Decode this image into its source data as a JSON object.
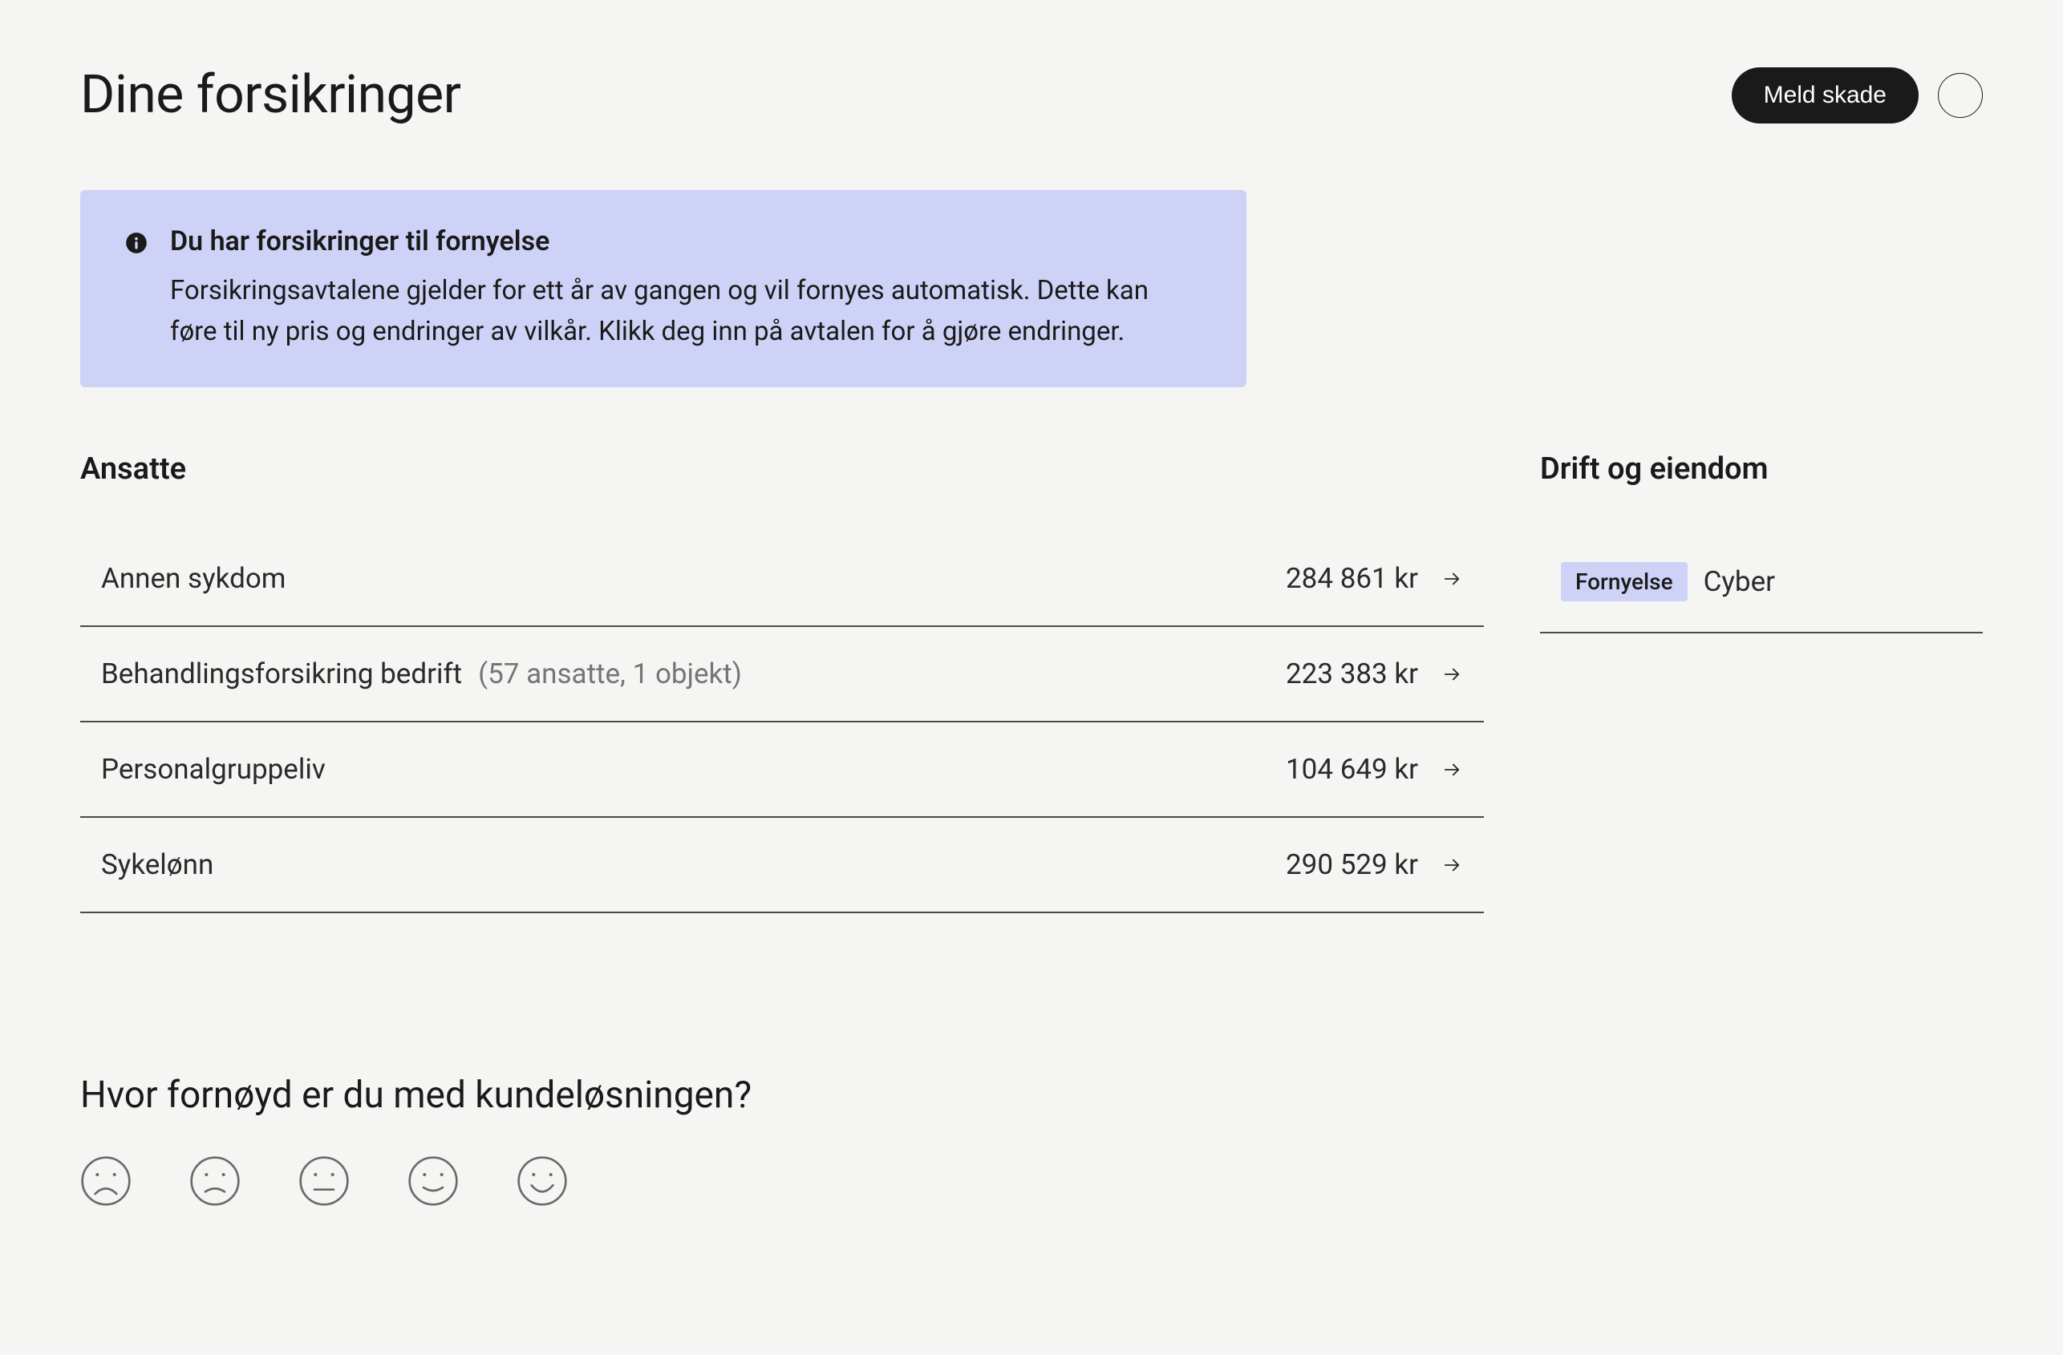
{
  "header": {
    "title": "Dine forsikringer",
    "cta_label": "Meld skade"
  },
  "alert": {
    "title": "Du har forsikringer til fornyelse",
    "body": "Forsikringsavtalene gjelder for ett år av gangen og vil fornyes automatisk. Dette kan føre til ny pris og endringer av vilkår. Klikk deg inn på avtalen for å gjøre endringer."
  },
  "sections": {
    "left": {
      "title": "Ansatte",
      "items": [
        {
          "name": "Annen sykdom",
          "meta": "",
          "price": "284 861 kr"
        },
        {
          "name": "Behandlingsforsikring bedrift",
          "meta": "(57 ansatte, 1 objekt)",
          "price": "223 383 kr"
        },
        {
          "name": "Personalgruppeliv",
          "meta": "",
          "price": "104 649 kr"
        },
        {
          "name": "Sykelønn",
          "meta": "",
          "price": "290 529 kr"
        }
      ]
    },
    "right": {
      "title": "Drift og eiendom",
      "items": [
        {
          "badge": "Fornyelse",
          "name": "Cyber"
        }
      ]
    }
  },
  "feedback": {
    "title": "Hvor fornøyd er du med kundeløsningen?",
    "levels": [
      "very-sad",
      "sad",
      "neutral",
      "happy",
      "very-happy"
    ]
  }
}
